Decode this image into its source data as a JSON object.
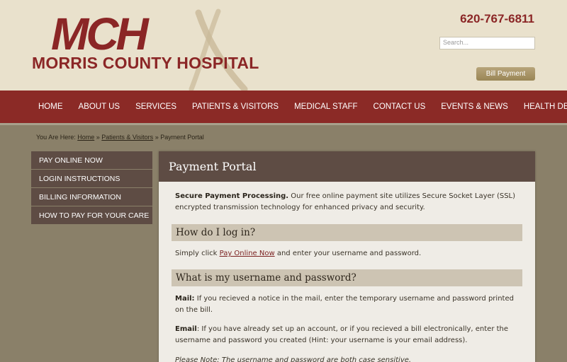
{
  "header": {
    "logo_letters": "MCH",
    "logo_name": "MORRIS COUNTY HOSPITAL",
    "phone": "620-767-6811",
    "search_placeholder": "Search...",
    "bill_payment": "Bill Payment"
  },
  "nav": {
    "items": [
      "HOME",
      "ABOUT US",
      "SERVICES",
      "PATIENTS & VISITORS",
      "MEDICAL STAFF",
      "CONTACT US",
      "EVENTS & NEWS",
      "HEALTH DEPT"
    ]
  },
  "breadcrumb": {
    "prefix": "You Are Here:",
    "home": "Home",
    "sep": "»",
    "section": "Patients & Visitors",
    "current": "Payment Portal"
  },
  "sidebar": {
    "items": [
      "PAY ONLINE NOW",
      "LOGIN INSTRUCTIONS",
      "BILLING INFORMATION",
      "HOW TO PAY FOR YOUR CARE"
    ]
  },
  "content": {
    "title": "Payment Portal",
    "intro_bold": "Secure Payment Processing.",
    "intro_text": " Our free online payment site utilizes Secure Socket Layer (SSL) encrypted transmission technology for enhanced privacy and security.",
    "h_login": "How do I log in?",
    "login_pre": "Simply click ",
    "login_link": "Pay Online Now",
    "login_post": " and enter your username and password.",
    "h_username": "What is my username and password?",
    "mail_bold": "Mail:",
    "mail_text": " If you recieved a notice in the mail, enter the temporary username and password printed on the bill.",
    "email_bold": "Email",
    "email_text": ": If you have already set up an account, or if you recieved a bill electronically, enter the username and password you created (Hint: your username is your email address).",
    "note": "Please Note: The username and password are both case sensitive."
  }
}
